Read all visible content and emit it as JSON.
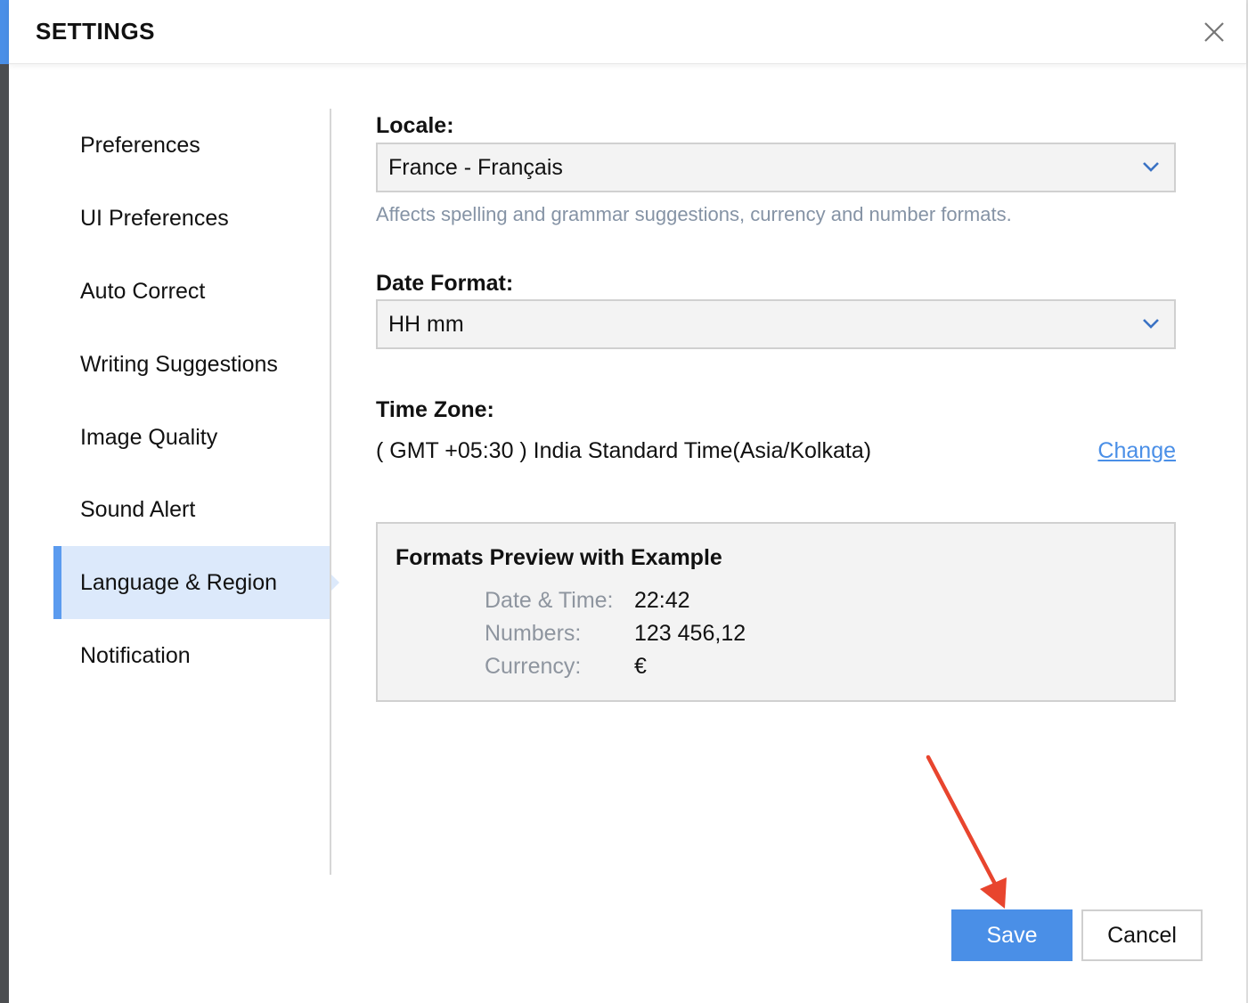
{
  "header": {
    "title": "SETTINGS",
    "close_icon": "close-icon"
  },
  "sidebar": {
    "items": [
      {
        "label": "Preferences",
        "active": false
      },
      {
        "label": "UI Preferences",
        "active": false
      },
      {
        "label": "Auto Correct",
        "active": false
      },
      {
        "label": "Writing Suggestions",
        "active": false
      },
      {
        "label": "Image Quality",
        "active": false
      },
      {
        "label": "Sound Alert",
        "active": false
      },
      {
        "label": "Language & Region",
        "active": true
      },
      {
        "label": "Notification",
        "active": false
      }
    ]
  },
  "locale": {
    "label": "Locale:",
    "value": "France - Français",
    "hint": "Affects spelling and grammar suggestions, currency and number formats."
  },
  "date_format": {
    "label": "Date Format:",
    "value": "HH mm"
  },
  "time_zone": {
    "label": "Time Zone:",
    "value": "( GMT +05:30 ) India Standard Time(Asia/Kolkata)",
    "change_label": "Change"
  },
  "preview": {
    "title": "Formats Preview with Example",
    "rows": [
      {
        "key": "Date & Time:",
        "value": "22:42"
      },
      {
        "key": "Numbers:",
        "value": "123 456,12"
      },
      {
        "key": "Currency:",
        "value": "€"
      }
    ]
  },
  "buttons": {
    "save": "Save",
    "cancel": "Cancel"
  },
  "colors": {
    "accent": "#4a8fe7",
    "active_bg": "#dce9fb",
    "annotation_arrow": "#e8452e"
  }
}
